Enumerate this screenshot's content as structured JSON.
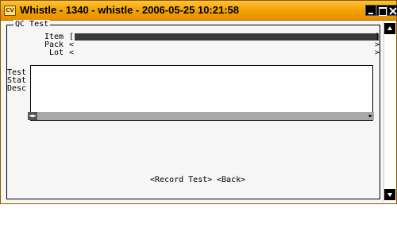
{
  "window": {
    "title": "Whistle - 1340 - whistle - 2006-05-25 10:21:58",
    "app_icon_text": "CV"
  },
  "form": {
    "frame_title": "QC Test",
    "fields": {
      "item_label": "Item",
      "item_bracket": "[",
      "item_end_bracket": "]",
      "pack_label": "Pack",
      "pack_open": "<",
      "pack_close": ">",
      "lot_label": "Lot",
      "lot_open": "<",
      "lot_close": ">"
    },
    "labels": {
      "test": "Test",
      "stat": "Stat",
      "desc": "Desc"
    },
    "scroll_left_glyph": "◄►",
    "scroll_right_glyph": "►"
  },
  "buttons": {
    "record_test": "<Record Test>",
    "back": "<Back>"
  },
  "colors": {
    "titlebar": "#f0a000",
    "field_fill": "#3a3a3a",
    "scroll_track": "#a8a8a8"
  }
}
